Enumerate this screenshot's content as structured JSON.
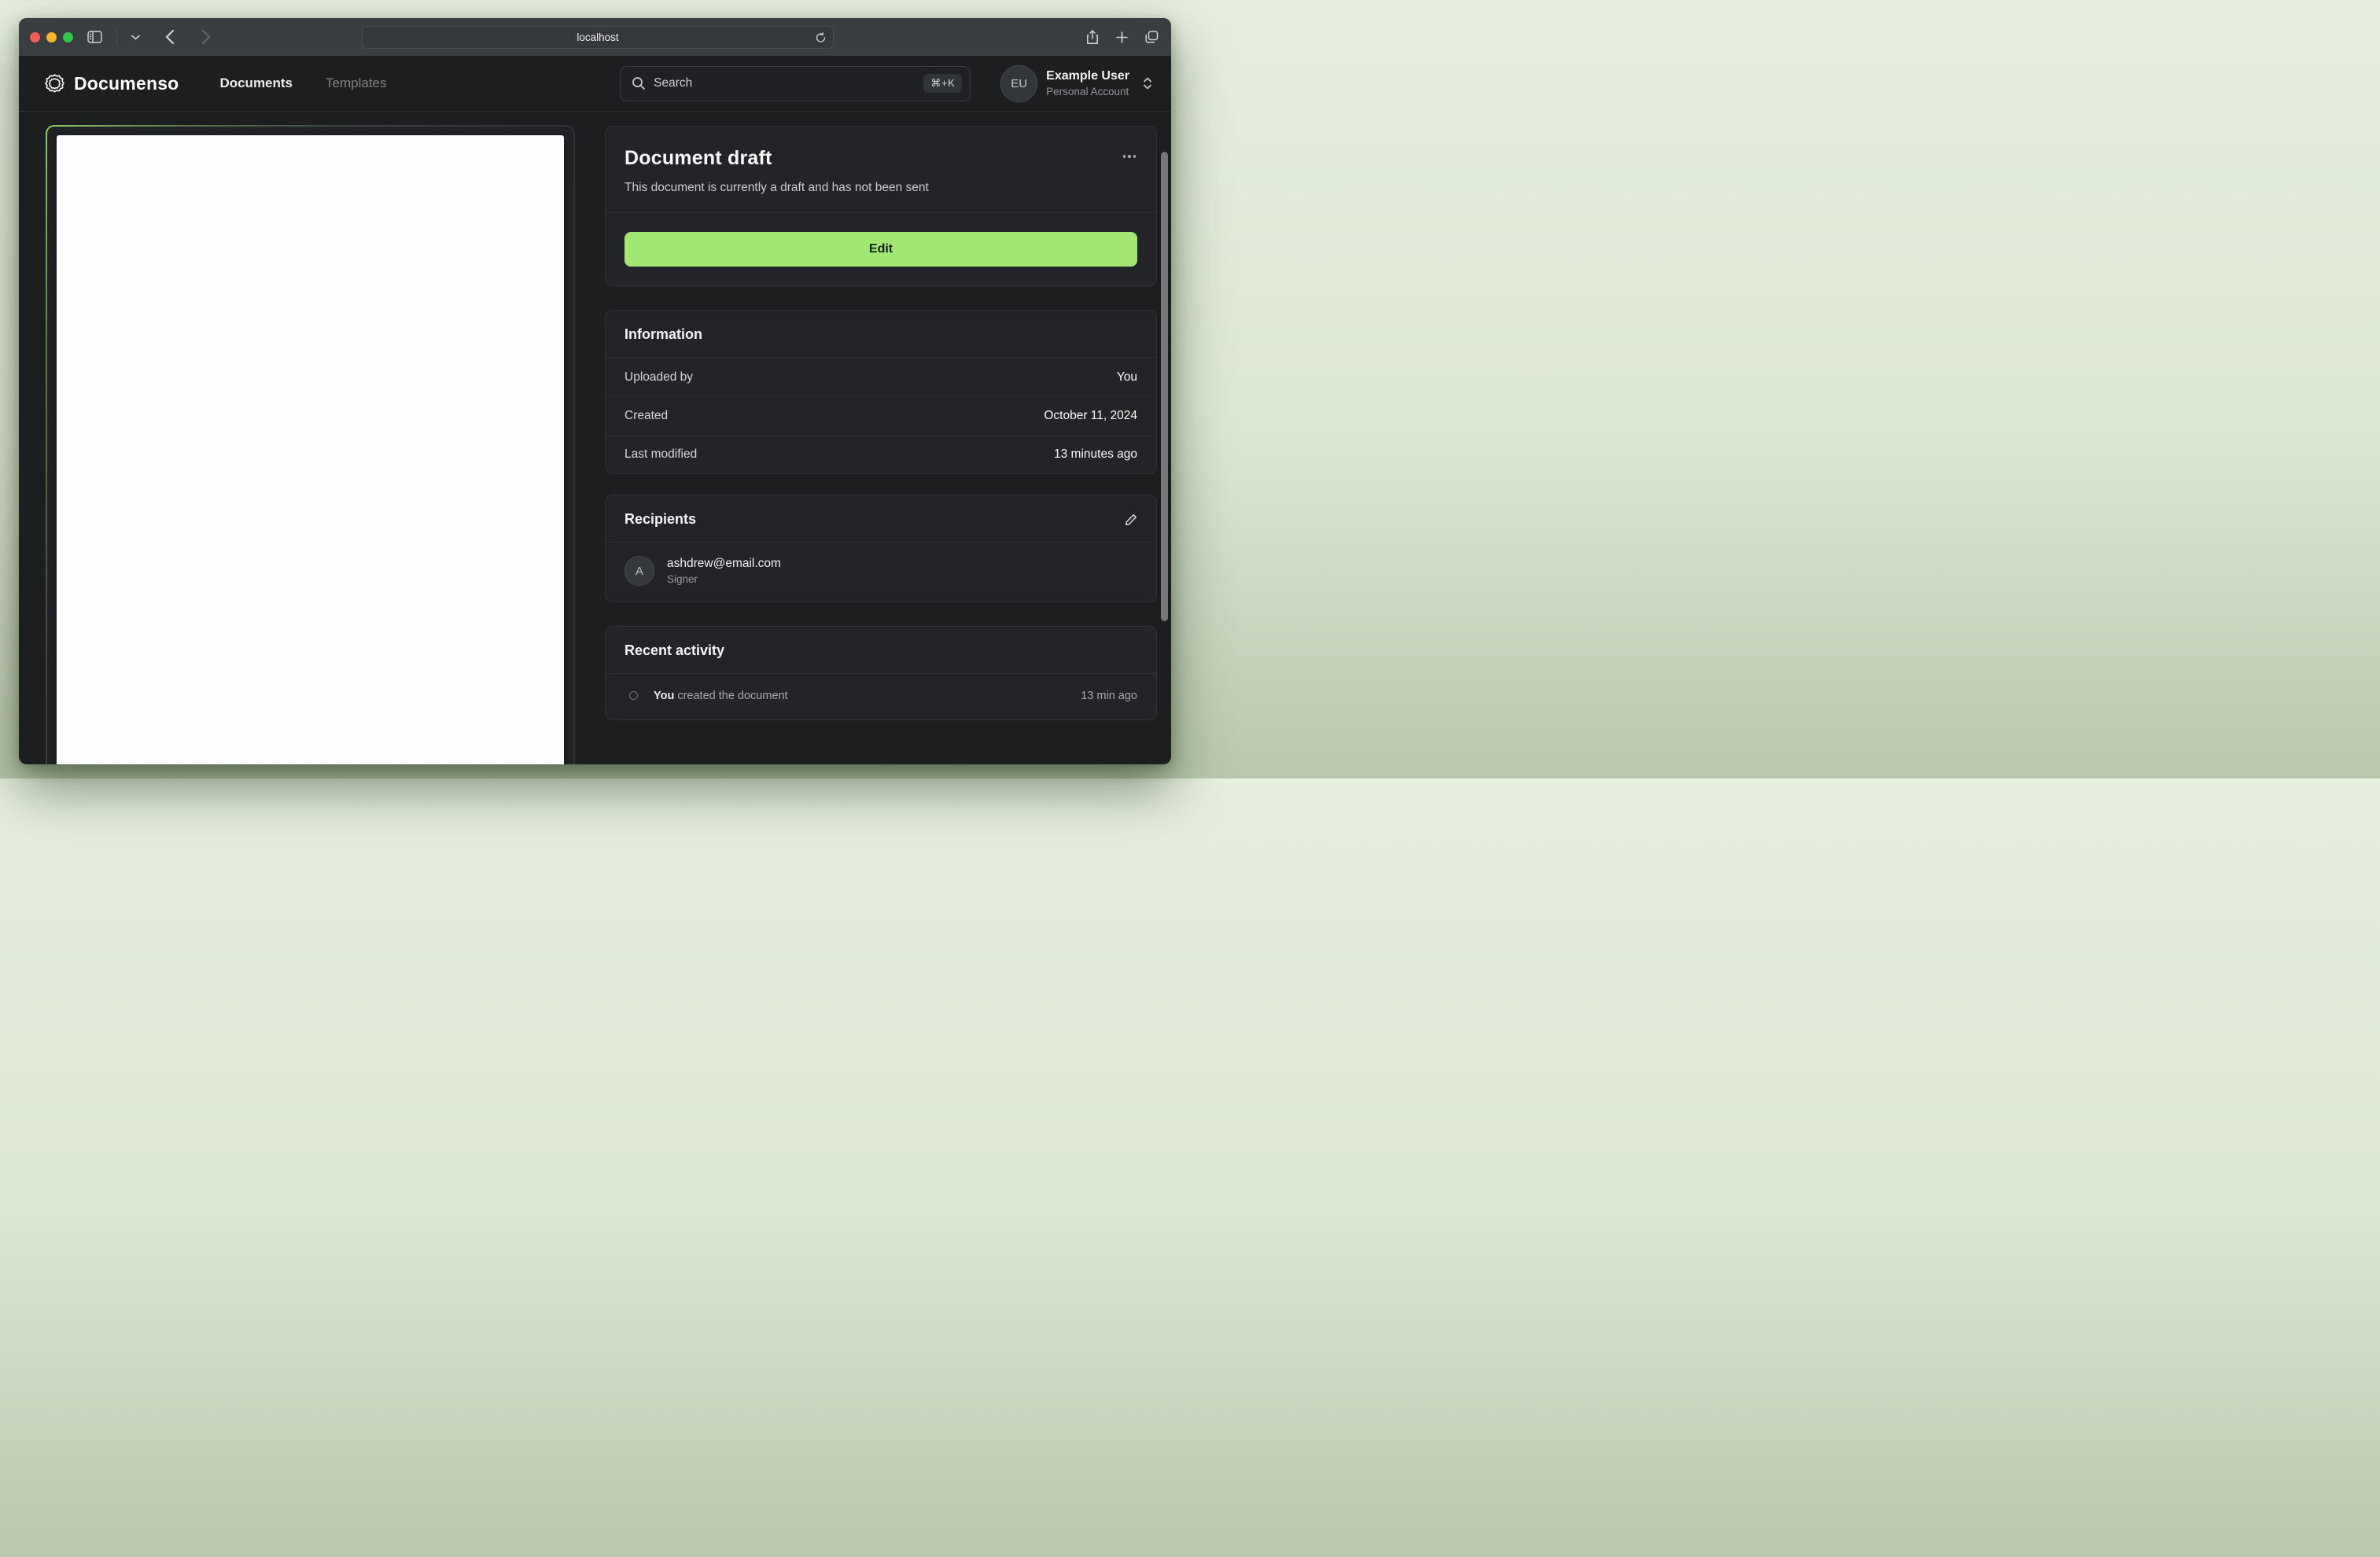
{
  "browser": {
    "url": "localhost"
  },
  "header": {
    "brand": "Documenso",
    "nav": [
      {
        "label": "Documents",
        "active": true
      },
      {
        "label": "Templates",
        "active": false
      }
    ],
    "search": {
      "placeholder": "Search",
      "shortcut": "⌘+K"
    },
    "user": {
      "initials": "EU",
      "name": "Example User",
      "account": "Personal Account"
    }
  },
  "status_card": {
    "title": "Document draft",
    "description": "This document is currently a draft and has not been sent",
    "primary_action": "Edit"
  },
  "information_card": {
    "title": "Information",
    "rows": [
      {
        "label": "Uploaded by",
        "value": "You"
      },
      {
        "label": "Created",
        "value": "October 11, 2024"
      },
      {
        "label": "Last modified",
        "value": "13 minutes ago"
      }
    ]
  },
  "recipients_card": {
    "title": "Recipients",
    "recipients": [
      {
        "initial": "A",
        "email": "ashdrew@email.com",
        "role": "Signer"
      }
    ]
  },
  "activity_card": {
    "title": "Recent activity",
    "items": [
      {
        "actor": "You",
        "action": "created the document",
        "time": "13 min ago"
      }
    ]
  },
  "colors": {
    "accent_green": "#a2e771",
    "chrome_bar": "#3b3e41",
    "page_bg": "#1d1e20",
    "card_bg": "#232427",
    "desktop_top": "#e7efdf",
    "desktop_bottom": "#b9c8ac",
    "traffic_red": "#f45c53",
    "traffic_yellow": "#f5b62e",
    "traffic_green": "#33c748"
  }
}
